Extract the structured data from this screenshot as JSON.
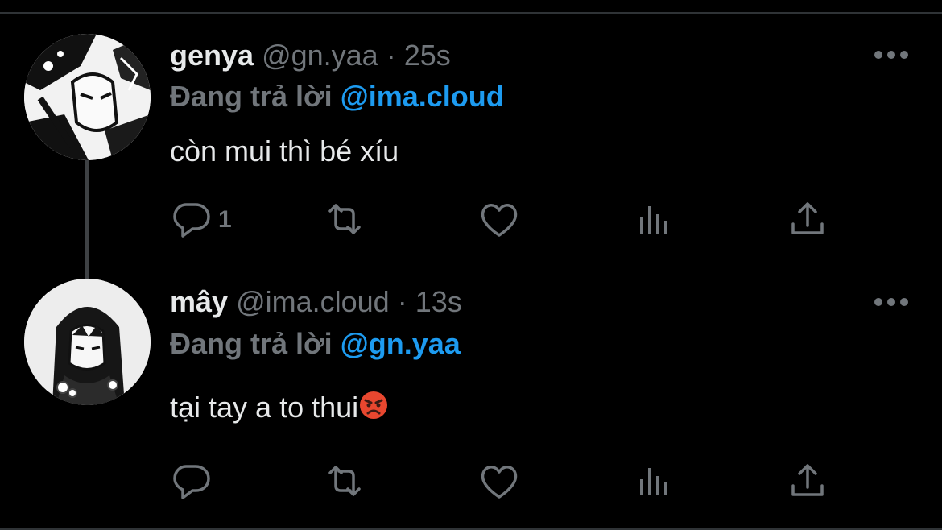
{
  "colors": {
    "background": "#000000",
    "text": "#e7e9ea",
    "secondary": "#71767b",
    "mention": "#1d9bf0",
    "divider": "#2f3336"
  },
  "tweets": [
    {
      "name": "genya",
      "handle": "@gn.yaa",
      "separator": "·",
      "time": "25s",
      "reply_prefix": "Đang trả lời",
      "reply_to": "@ima.cloud",
      "text": "còn mui thì bé xíu",
      "reply_count": "1",
      "avatar_icon": "manga-character-avatar"
    },
    {
      "name": "mây",
      "handle": "@ima.cloud",
      "separator": "·",
      "time": "13s",
      "reply_prefix": "Đang trả lời",
      "reply_to": "@gn.yaa",
      "text": "tại tay a to thui",
      "emoji": "angry-face-emoji",
      "reply_count": "",
      "avatar_icon": "manga-character-avatar"
    }
  ],
  "actions": [
    "reply-icon",
    "retweet-icon",
    "like-icon",
    "analytics-icon",
    "share-icon"
  ]
}
